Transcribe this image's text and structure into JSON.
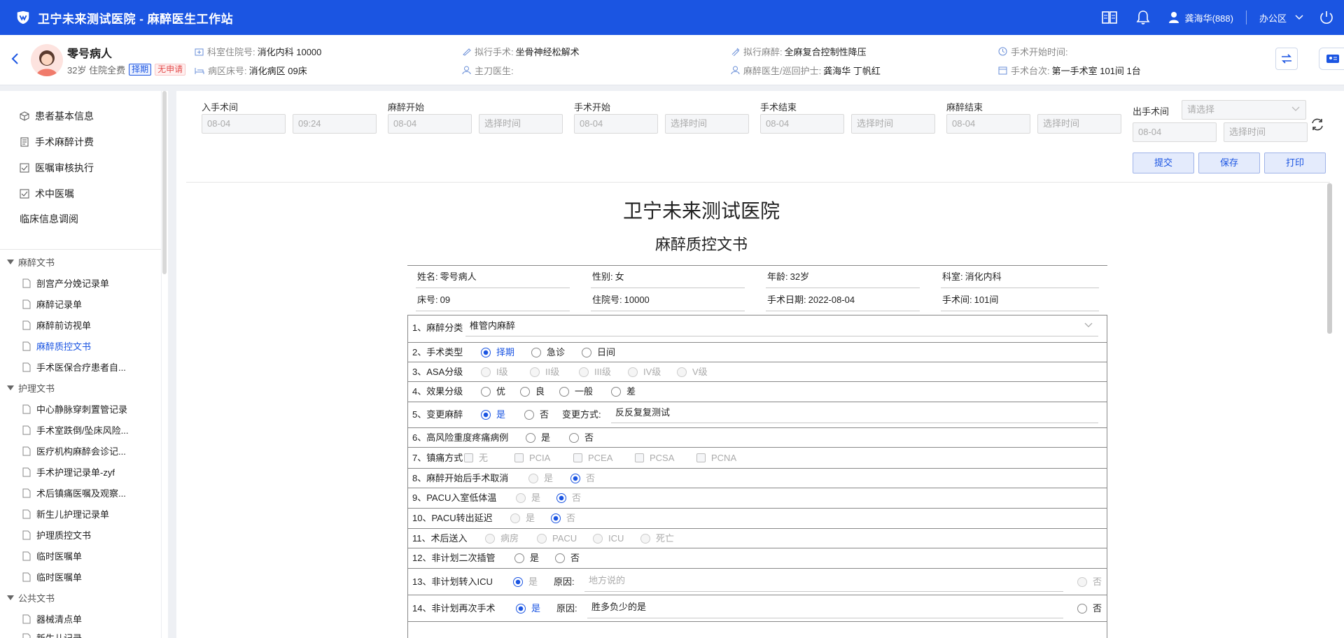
{
  "header": {
    "title": "卫宁未来测试医院 - 麻醉医生工作站",
    "user": "龚海华(888)",
    "area": "办公区"
  },
  "patient": {
    "name": "零号病人",
    "meta": "32岁 住院全费",
    "tag_type": "择期",
    "tag_apply": "无申请",
    "dept_label": "科室住院号:",
    "dept_value": "消化内科 10000",
    "ward_label": "病区床号:",
    "ward_value": "消化病区 09床",
    "op_label": "拟行手术:",
    "op_value": "坐骨神经松解术",
    "surgeon_label": "主刀医生:",
    "surgeon_value": "",
    "anes_label": "拟行麻醉:",
    "anes_value": "全麻复合控制性降压",
    "nurse_label": "麻醉医生/巡回护士:",
    "nurse_value": "龚海华 丁帆红",
    "start_label": "手术开始时间:",
    "start_value": "",
    "room_label": "手术台次:",
    "room_value": "第一手术室 101间 1台"
  },
  "sidebar": {
    "nav": [
      "患者基本信息",
      "手术麻醉计费",
      "医嘱审核执行",
      "术中医嘱",
      "临床信息调阅"
    ],
    "groups": [
      {
        "title": "麻醉文书",
        "items": [
          "剖宫产分娩记录单",
          "麻醉记录单",
          "麻醉前访视单",
          "麻醉质控文书",
          "手术医保合疗患者自..."
        ]
      },
      {
        "title": "护理文书",
        "items": [
          "中心静脉穿刺置管记录",
          "手术室跌倒/坠床风险...",
          "医疗机构麻醉会诊记...",
          "手术护理记录单-zyf",
          "术后镇痛医嘱及观察...",
          "新生儿护理记录单",
          "护理质控文书",
          "临时医嘱单",
          "临时医嘱单"
        ]
      },
      {
        "title": "公共文书",
        "items": [
          "器械清点单",
          "新生儿记录"
        ]
      }
    ],
    "active_item": "麻醉质控文书"
  },
  "timebar": {
    "enter": {
      "label": "入手术间",
      "date": "08-04",
      "time": "09:24"
    },
    "anes_start": {
      "label": "麻醉开始",
      "date": "08-04",
      "time": "选择时间"
    },
    "op_start": {
      "label": "手术开始",
      "date": "08-04",
      "time": "选择时间"
    },
    "op_end": {
      "label": "手术结束",
      "date": "08-04",
      "time": "选择时间"
    },
    "anes_end": {
      "label": "麻醉结束",
      "date": "08-04",
      "time": "选择时间"
    },
    "leave": {
      "label": "出手术间",
      "select": "请选择",
      "date": "08-04",
      "time": "选择时间"
    },
    "buttons": {
      "submit": "提交",
      "save": "保存",
      "print": "打印"
    }
  },
  "doc": {
    "hospital": "卫宁未来测试医院",
    "title": "麻醉质控文书",
    "fields": {
      "name_label": "姓名:",
      "name": "零号病人",
      "sex_label": "性别:",
      "sex": "女",
      "age_label": "年龄:",
      "age": "32岁",
      "dept_label": "科室:",
      "dept": "消化内科",
      "bed_label": "床号:",
      "bed": "09",
      "inpat_label": "住院号:",
      "inpat": "10000",
      "date_label": "手术日期:",
      "date": "2022-08-04",
      "room_label": "手术间:",
      "room": "101间"
    },
    "q1": {
      "label": "1、麻醉分类",
      "value": "椎管内麻醉"
    },
    "q2": {
      "label": "2、手术类型",
      "opts": [
        "择期",
        "急诊",
        "日间"
      ]
    },
    "q3": {
      "label": "3、ASA分级",
      "opts": [
        "I级",
        "II级",
        "III级",
        "IV级",
        "V级"
      ]
    },
    "q4": {
      "label": "4、效果分级",
      "opts": [
        "优",
        "良",
        "一般",
        "差"
      ]
    },
    "q5": {
      "label": "5、变更麻醉",
      "opts": [
        "是",
        "否"
      ],
      "change_label": "变更方式:",
      "change_value": "反反复复测试"
    },
    "q6": {
      "label": "6、高风险重度疼痛病例",
      "opts": [
        "是",
        "否"
      ]
    },
    "q7": {
      "label": "7、镇痛方式",
      "opts": [
        "无",
        "PCIA",
        "PCEA",
        "PCSA",
        "PCNA"
      ]
    },
    "q8": {
      "label": "8、麻醉开始后手术取消",
      "opts": [
        "是",
        "否"
      ]
    },
    "q9": {
      "label": "9、PACU入室低体温",
      "opts": [
        "是",
        "否"
      ]
    },
    "q10": {
      "label": "10、PACU转出延迟",
      "opts": [
        "是",
        "否"
      ]
    },
    "q11": {
      "label": "11、术后送入",
      "opts": [
        "病房",
        "PACU",
        "ICU",
        "死亡"
      ]
    },
    "q12": {
      "label": "12、非计划二次插管",
      "opts": [
        "是",
        "否"
      ]
    },
    "q13": {
      "label": "13、非计划转入ICU",
      "yes": "是",
      "reason_label": "原因:",
      "reason_placeholder": "地方说的",
      "no": "否"
    },
    "q14": {
      "label": "14、非计划再次手术",
      "yes": "是",
      "reason_label": "原因:",
      "reason_value": "胜多负少的是",
      "no": "否"
    }
  },
  "colors": {
    "primary": "#1b55e2",
    "bg": "#eef0f4",
    "danger": "#e34d4d"
  }
}
